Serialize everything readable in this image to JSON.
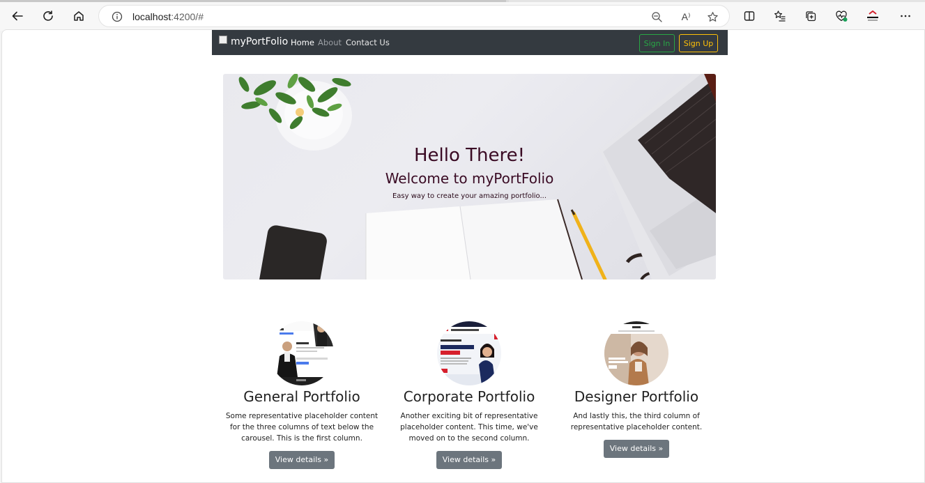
{
  "browser": {
    "url_host": "localhost",
    "url_rest": ":4200/#",
    "read_aloud_glyph": "A⁾"
  },
  "navbar": {
    "brand": "myPortFolio",
    "links": [
      "Home",
      "About",
      "Contact Us"
    ],
    "sign_in": "Sign In",
    "sign_up": "Sign Up"
  },
  "hero": {
    "title": "Hello There!",
    "subtitle": "Welcome to myPortFolio",
    "tagline": "Easy way to create your amazing portfolio..."
  },
  "cards": [
    {
      "title": "General Portfolio",
      "text": "Some representative placeholder content for the three columns of text below the carousel. This is the first column.",
      "button": "View details »"
    },
    {
      "title": "Corporate Portfolio",
      "text": "Another exciting bit of representative placeholder content. This time, we've moved on to the second column.",
      "button": "View details »"
    },
    {
      "title": "Designer Portfolio",
      "text": "And lastly this, the third column of representative placeholder content.",
      "button": "View details »"
    }
  ],
  "colors": {
    "navbar_bg": "#343a40",
    "success": "#28a745",
    "warning": "#ffc107",
    "secondary_btn": "#6c757d",
    "hero_text": "#3a0b24"
  }
}
